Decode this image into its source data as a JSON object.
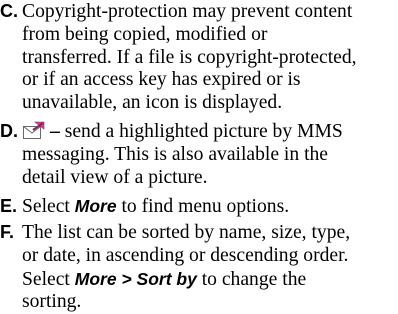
{
  "items": [
    {
      "letter": "C.",
      "lines": [
        "Copyright-protection may prevent content",
        "from being copied, modified or",
        "transferred. If a file is copyright-protected,",
        "or if an access key has expired or is",
        "unavailable, an icon is displayed."
      ]
    },
    {
      "letter": "D.",
      "icon": "send-mms-envelope-icon",
      "dash": "–",
      "lines": [
        "send a highlighted picture by MMS",
        "messaging. This is also available in the",
        "detail view of a picture."
      ]
    },
    {
      "letter": "E.",
      "prefix": "Select ",
      "emphasis": "More",
      "suffix": " to find menu options."
    },
    {
      "letter": "F.",
      "lines": [
        "The list can be sorted by name, size, type,",
        "or date, in ascending or descending order."
      ],
      "line3_prefix": "Select ",
      "line3_emphasis": "More > Sort by",
      "line3_suffix": " to change the",
      "line4": "sorting."
    }
  ]
}
